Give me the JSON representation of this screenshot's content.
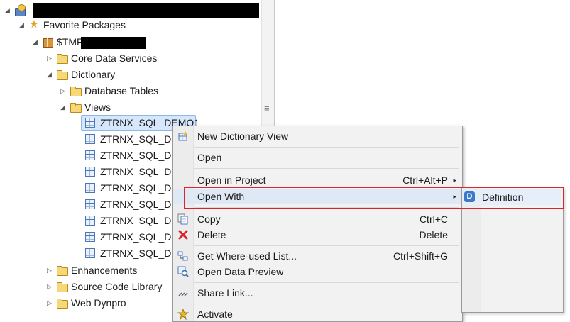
{
  "tree": {
    "items": [
      {
        "label": "",
        "icon": "project-icon",
        "expanded": true
      },
      {
        "label": "Favorite Packages",
        "icon": "star-icon",
        "expanded": true
      },
      {
        "label": "$TMP",
        "icon": "package-icon",
        "expanded": true
      },
      {
        "label": "Core Data Services",
        "icon": "folder-icon",
        "expanded": false
      },
      {
        "label": "Dictionary",
        "icon": "folder-icon",
        "expanded": true
      },
      {
        "label": "Database Tables",
        "icon": "folder-icon",
        "expanded": false
      },
      {
        "label": "Views",
        "icon": "folder-icon",
        "expanded": true
      },
      {
        "label": "ZTRNX_SQL_DEMO1",
        "icon": "view-table-icon"
      },
      {
        "label": "ZTRNX_SQL_DE",
        "icon": "view-table-icon"
      },
      {
        "label": "ZTRNX_SQL_DE",
        "icon": "view-table-icon"
      },
      {
        "label": "ZTRNX_SQL_DE",
        "icon": "view-table-icon"
      },
      {
        "label": "ZTRNX_SQL_DE",
        "icon": "view-table-icon"
      },
      {
        "label": "ZTRNX_SQL_DE",
        "icon": "view-table-icon"
      },
      {
        "label": "ZTRNX_SQL_DE",
        "icon": "view-table-icon"
      },
      {
        "label": "ZTRNX_SQL_DE",
        "icon": "view-table-icon"
      },
      {
        "label": "Enhancements",
        "icon": "folder-icon",
        "expanded": false
      },
      {
        "label": "Source Code Library",
        "icon": "folder-icon",
        "expanded": false
      },
      {
        "label": "Web Dynpro",
        "icon": "folder-icon",
        "expanded": false
      }
    ]
  },
  "context_menu": {
    "items": [
      {
        "label": "New Dictionary View",
        "shortcut": "",
        "icon": "new-view-icon"
      },
      {
        "label": "Open",
        "shortcut": ""
      },
      {
        "label": "Open in Project",
        "shortcut": "Ctrl+Alt+P",
        "submenu": true
      },
      {
        "label": "Open With",
        "shortcut": "",
        "submenu": true
      },
      {
        "label": "Copy",
        "shortcut": "Ctrl+C",
        "icon": "copy-icon"
      },
      {
        "label": "Delete",
        "shortcut": "Delete",
        "icon": "delete-icon"
      },
      {
        "label": "Get Where-used List...",
        "shortcut": "Ctrl+Shift+G",
        "icon": "where-used-icon"
      },
      {
        "label": "Open Data Preview",
        "shortcut": "",
        "icon": "data-preview-icon"
      },
      {
        "label": "Share Link...",
        "shortcut": "",
        "icon": "share-link-icon"
      },
      {
        "label": "Activate",
        "shortcut": "",
        "icon": "activate-icon"
      }
    ],
    "submenu_arrow": "▸"
  },
  "submenu": {
    "items": [
      {
        "label": "Definition",
        "badge": "D",
        "icon": "definition-icon"
      }
    ]
  },
  "colors": {
    "highlight_border": "#d9262c",
    "selection_bg": "#d6e7fb"
  }
}
